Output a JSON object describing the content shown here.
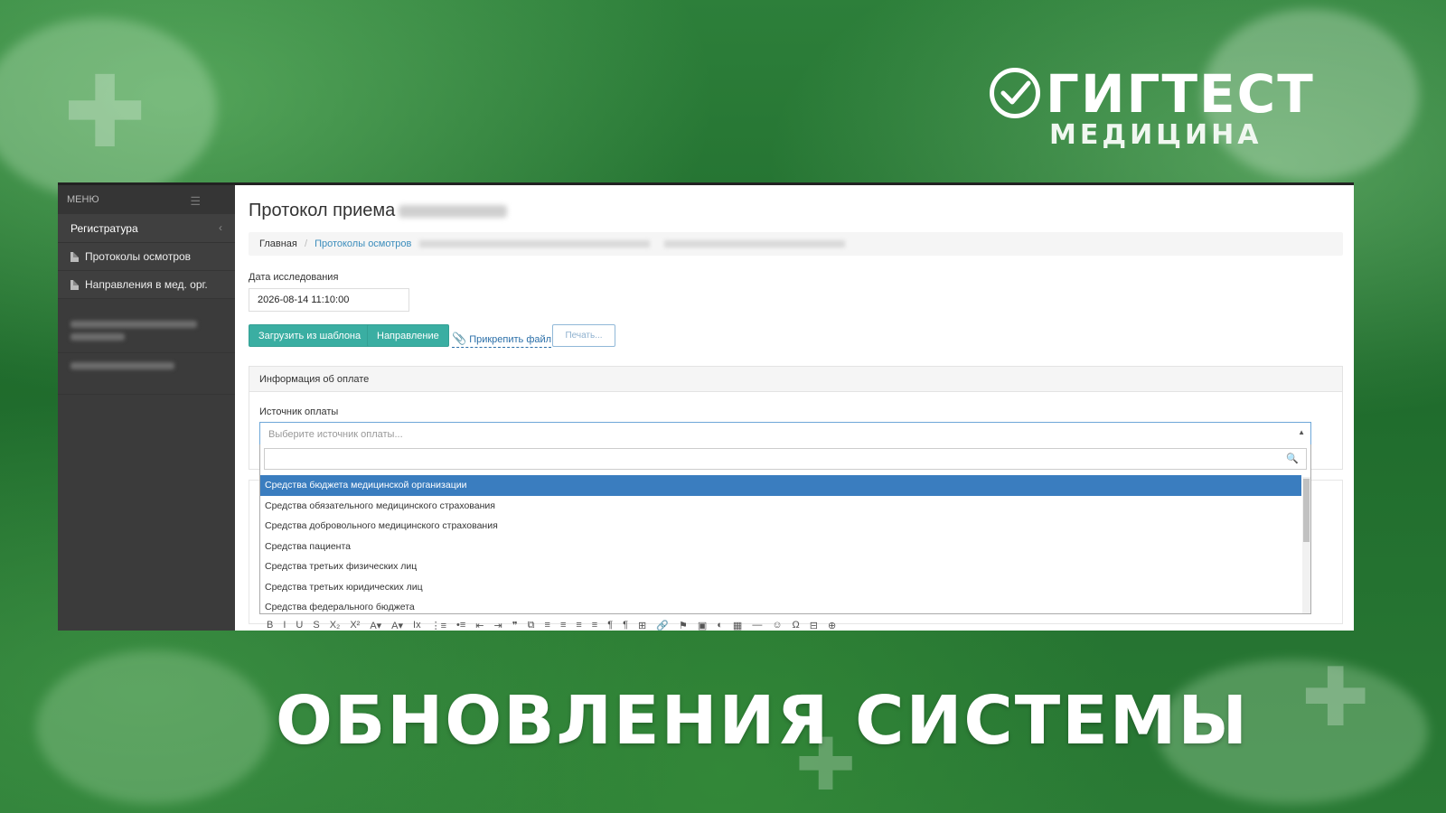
{
  "brand": {
    "name": "ГИГТЕСТ",
    "sub": "МЕДИЦИНА"
  },
  "headline": "ОБНОВЛЕНИЯ СИСТЕМЫ",
  "sidebar": {
    "menu_label": "МЕНЮ",
    "group_label": "Регистратура",
    "items": [
      {
        "label": "Протоколы осмотров"
      },
      {
        "label": "Направления в мед. орг."
      }
    ]
  },
  "page": {
    "title": "Протокол приема",
    "breadcrumb": {
      "home": "Главная",
      "section": "Протоколы осмотров"
    },
    "date_label": "Дата исследования",
    "date_value": "2026-08-14 11:10:00",
    "buttons": {
      "template": "Загрузить из шаблона",
      "direction": "Направление",
      "attach": "Прикрепить файл",
      "print": "Печать..."
    },
    "payment_panel": {
      "header": "Информация об оплате",
      "source_label": "Источник оплаты",
      "source_placeholder": "Выберите источник оплаты...",
      "options": [
        "Средства бюджета медицинской организации",
        "Средства обязательного медицинского страхования",
        "Средства добровольного медицинского страхования",
        "Средства пациента",
        "Средства третьих физических лиц",
        "Средства третьих юридических лиц",
        "Средства федерального бюджета"
      ],
      "selected_index": 0
    },
    "editor_toolbar": [
      "B",
      "I",
      "U",
      "S",
      "X₂",
      "X²",
      "A▾",
      "A▾",
      "Ix",
      "⋮≡",
      "•≡",
      "⇤",
      "⇥",
      "❞",
      "⧉",
      "≡",
      "≡",
      "≡",
      "≡",
      "¶",
      "¶",
      "⊞",
      "🔗",
      "⚑",
      "▣",
      "◐",
      "▦",
      "—",
      "☺",
      "Ω",
      "⊟",
      "⊕"
    ]
  },
  "colors": {
    "accent_button": "#3aaea2",
    "selected_option": "#3a7dbf",
    "sidebar_bg": "#3b3b3b",
    "background_green": "#2d7f3a"
  }
}
